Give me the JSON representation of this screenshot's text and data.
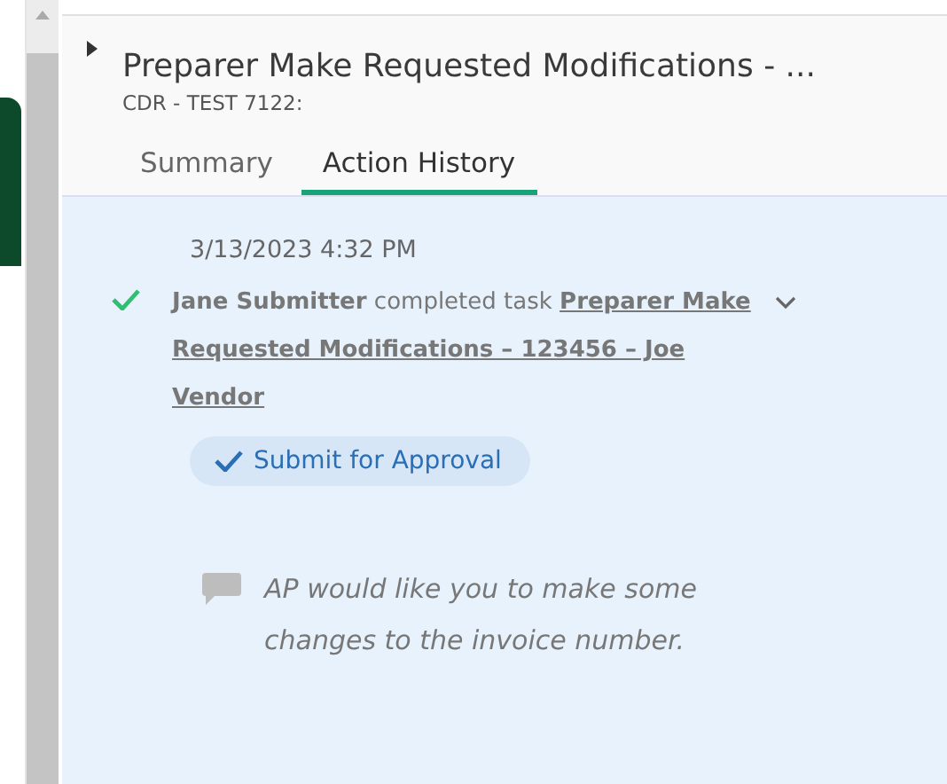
{
  "header": {
    "title": "Preparer Make Requested Modifications - ...",
    "subtitle": "CDR - TEST 7122:",
    "collapsed": true
  },
  "tabs": [
    {
      "label": "Summary",
      "selected": false
    },
    {
      "label": "Action History",
      "selected": true
    }
  ],
  "history": [
    {
      "timestamp": "3/13/2023 4:32 PM",
      "completed": true,
      "text": "**Jane Submitter** completed task **Preparer Make Requested Modifications – 123456 – Joe Vendor**",
      "expanded": false,
      "action": "Submit for Approval",
      "comment": "AP would like you to make some changes to the invoice number."
    }
  ]
}
